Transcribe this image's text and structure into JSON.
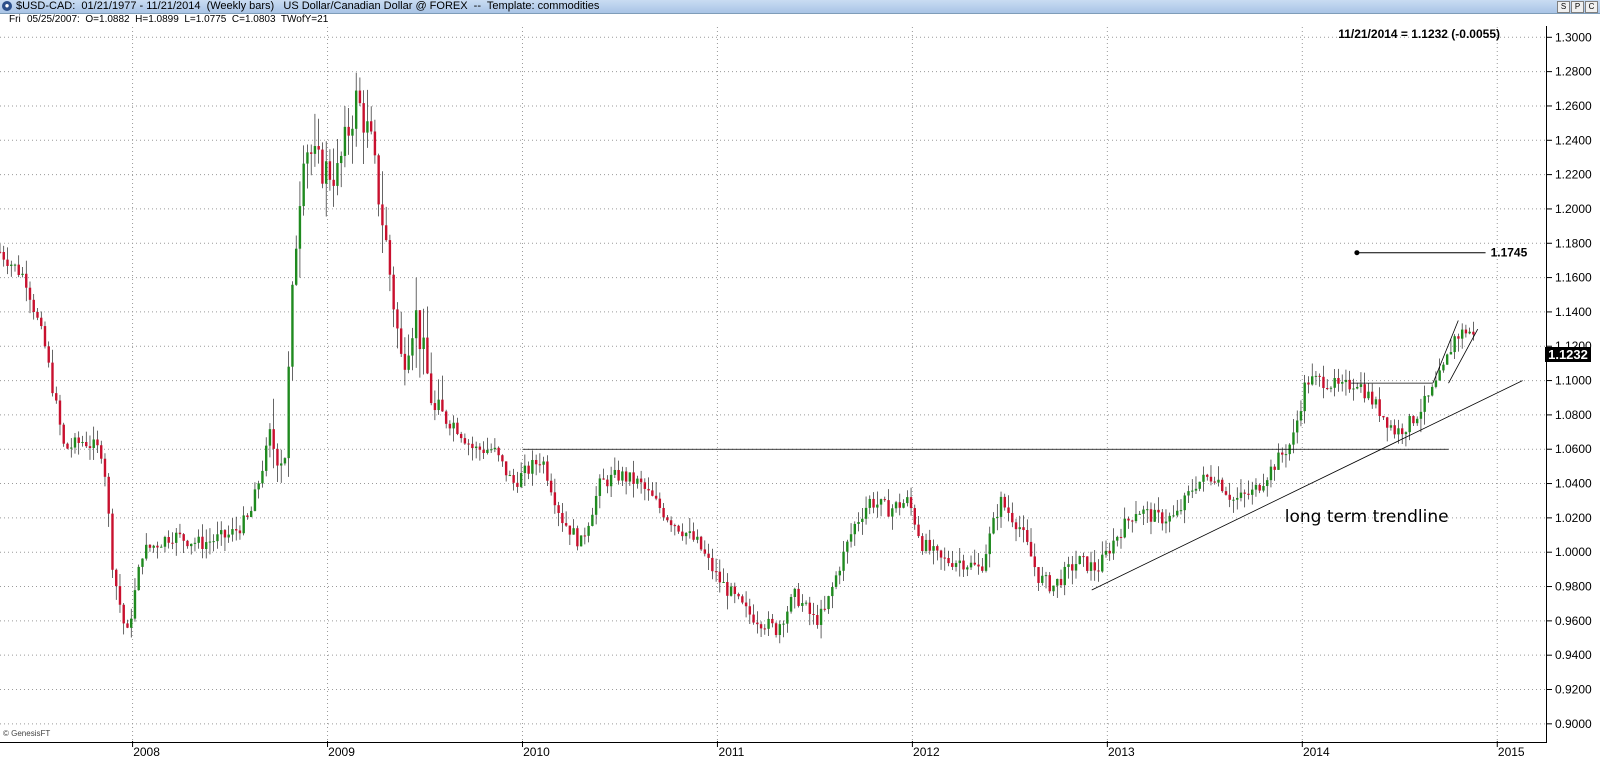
{
  "window": {
    "title": "$USD-CAD:  01/21/1977 - 11/21/2014  (Weekly bars)   US Dollar/Canadian Dollar @ FOREX  --  Template: commodities",
    "buttons": [
      "S",
      "P",
      "C"
    ]
  },
  "infobar": {
    "day": "Fri",
    "ohlc": "05/25/2007:  O=1.0882  H=1.0899  L=1.0775  C=1.0803  TWofY=21"
  },
  "readout": "11/21/2014 = 1.1232 (-0.0055)",
  "last_price_flag": "1.1232",
  "watermark": "© GenesisFT",
  "colors": {
    "up": "#1f8a1f",
    "down": "#c8102e",
    "wick": "#000000",
    "grid": "#9a9a9a"
  },
  "chart_data": {
    "type": "candlestick",
    "timeframe": "weekly",
    "x_ticks": [
      "2008",
      "2009",
      "2010",
      "2011",
      "2012",
      "2013",
      "2014",
      "2015"
    ],
    "x_range": [
      2007.32,
      2015.25
    ],
    "y_ticks": [
      "0.9000",
      "0.9200",
      "0.9400",
      "0.9600",
      "0.9800",
      "1.0000",
      "1.0200",
      "1.0400",
      "1.0600",
      "1.0800",
      "1.1000",
      "1.1200",
      "1.1400",
      "1.1600",
      "1.1800",
      "1.2000",
      "1.2200",
      "1.2400",
      "1.2600",
      "1.2800",
      "1.3000"
    ],
    "ylim": [
      0.89,
      1.306
    ],
    "grid": true,
    "price_path": [
      [
        2007.32,
        1.175
      ],
      [
        2007.45,
        1.16
      ],
      [
        2007.55,
        1.12
      ],
      [
        2007.65,
        1.06
      ],
      [
        2007.75,
        1.065
      ],
      [
        2007.85,
        1.058
      ],
      [
        2007.9,
        0.99
      ],
      [
        2007.97,
        0.95
      ],
      [
        2008.05,
        1.0
      ],
      [
        2008.2,
        1.01
      ],
      [
        2008.35,
        1.005
      ],
      [
        2008.5,
        1.01
      ],
      [
        2008.6,
        1.02
      ],
      [
        2008.7,
        1.065
      ],
      [
        2008.78,
        1.055
      ],
      [
        2008.83,
        1.17
      ],
      [
        2008.88,
        1.24
      ],
      [
        2008.95,
        1.225
      ],
      [
        2009.05,
        1.22
      ],
      [
        2009.15,
        1.265
      ],
      [
        2009.22,
        1.24
      ],
      [
        2009.3,
        1.18
      ],
      [
        2009.38,
        1.11
      ],
      [
        2009.45,
        1.14
      ],
      [
        2009.55,
        1.08
      ],
      [
        2009.65,
        1.075
      ],
      [
        2009.75,
        1.06
      ],
      [
        2009.85,
        1.06
      ],
      [
        2009.95,
        1.04
      ],
      [
        2010.1,
        1.055
      ],
      [
        2010.2,
        1.02
      ],
      [
        2010.3,
        1.005
      ],
      [
        2010.4,
        1.04
      ],
      [
        2010.5,
        1.045
      ],
      [
        2010.6,
        1.04
      ],
      [
        2010.75,
        1.02
      ],
      [
        2010.9,
        1.005
      ],
      [
        2011.0,
        0.985
      ],
      [
        2011.15,
        0.965
      ],
      [
        2011.3,
        0.955
      ],
      [
        2011.4,
        0.975
      ],
      [
        2011.5,
        0.96
      ],
      [
        2011.55,
        0.965
      ],
      [
        2011.62,
        0.99
      ],
      [
        2011.7,
        1.015
      ],
      [
        2011.78,
        1.03
      ],
      [
        2011.88,
        1.025
      ],
      [
        2011.98,
        1.03
      ],
      [
        2012.05,
        1.005
      ],
      [
        2012.15,
        0.995
      ],
      [
        2012.25,
        0.995
      ],
      [
        2012.35,
        0.99
      ],
      [
        2012.45,
        1.03
      ],
      [
        2012.55,
        1.015
      ],
      [
        2012.65,
        0.985
      ],
      [
        2012.72,
        0.98
      ],
      [
        2012.85,
        0.995
      ],
      [
        2012.95,
        0.99
      ],
      [
        2013.05,
        1.01
      ],
      [
        2013.15,
        1.025
      ],
      [
        2013.25,
        1.02
      ],
      [
        2013.35,
        1.02
      ],
      [
        2013.45,
        1.04
      ],
      [
        2013.55,
        1.045
      ],
      [
        2013.65,
        1.03
      ],
      [
        2013.75,
        1.035
      ],
      [
        2013.85,
        1.05
      ],
      [
        2013.95,
        1.065
      ],
      [
        2014.02,
        1.1
      ],
      [
        2014.12,
        1.1
      ],
      [
        2014.2,
        1.095
      ],
      [
        2014.28,
        1.1
      ],
      [
        2014.38,
        1.085
      ],
      [
        2014.48,
        1.07
      ],
      [
        2014.55,
        1.075
      ],
      [
        2014.65,
        1.09
      ],
      [
        2014.72,
        1.105
      ],
      [
        2014.78,
        1.125
      ],
      [
        2014.85,
        1.13
      ],
      [
        2014.89,
        1.1232
      ]
    ],
    "horizontal_levels": [
      {
        "name": "resistance-1.06",
        "y": 1.06,
        "x": [
          2010.0,
          2014.75
        ]
      },
      {
        "name": "pullback-1.0985",
        "y": 1.0985,
        "x": [
          2014.25,
          2014.67
        ]
      }
    ],
    "target": {
      "label": "1.1745",
      "y": 1.1745,
      "x": [
        2014.28,
        2014.94
      ]
    },
    "trendlines": [
      {
        "name": "long-term-trendline",
        "from": [
          2012.92,
          0.978
        ],
        "to": [
          2015.13,
          1.1
        ]
      },
      {
        "name": "channel-upper",
        "from": [
          2014.67,
          1.0985
        ],
        "to": [
          2014.8,
          1.135
        ]
      },
      {
        "name": "channel-lower",
        "from": [
          2014.75,
          1.0985
        ],
        "to": [
          2014.9,
          1.13
        ]
      }
    ],
    "annotations": [
      {
        "text": "long term trendline",
        "x": 2013.91,
        "y": 1.0175
      }
    ]
  }
}
